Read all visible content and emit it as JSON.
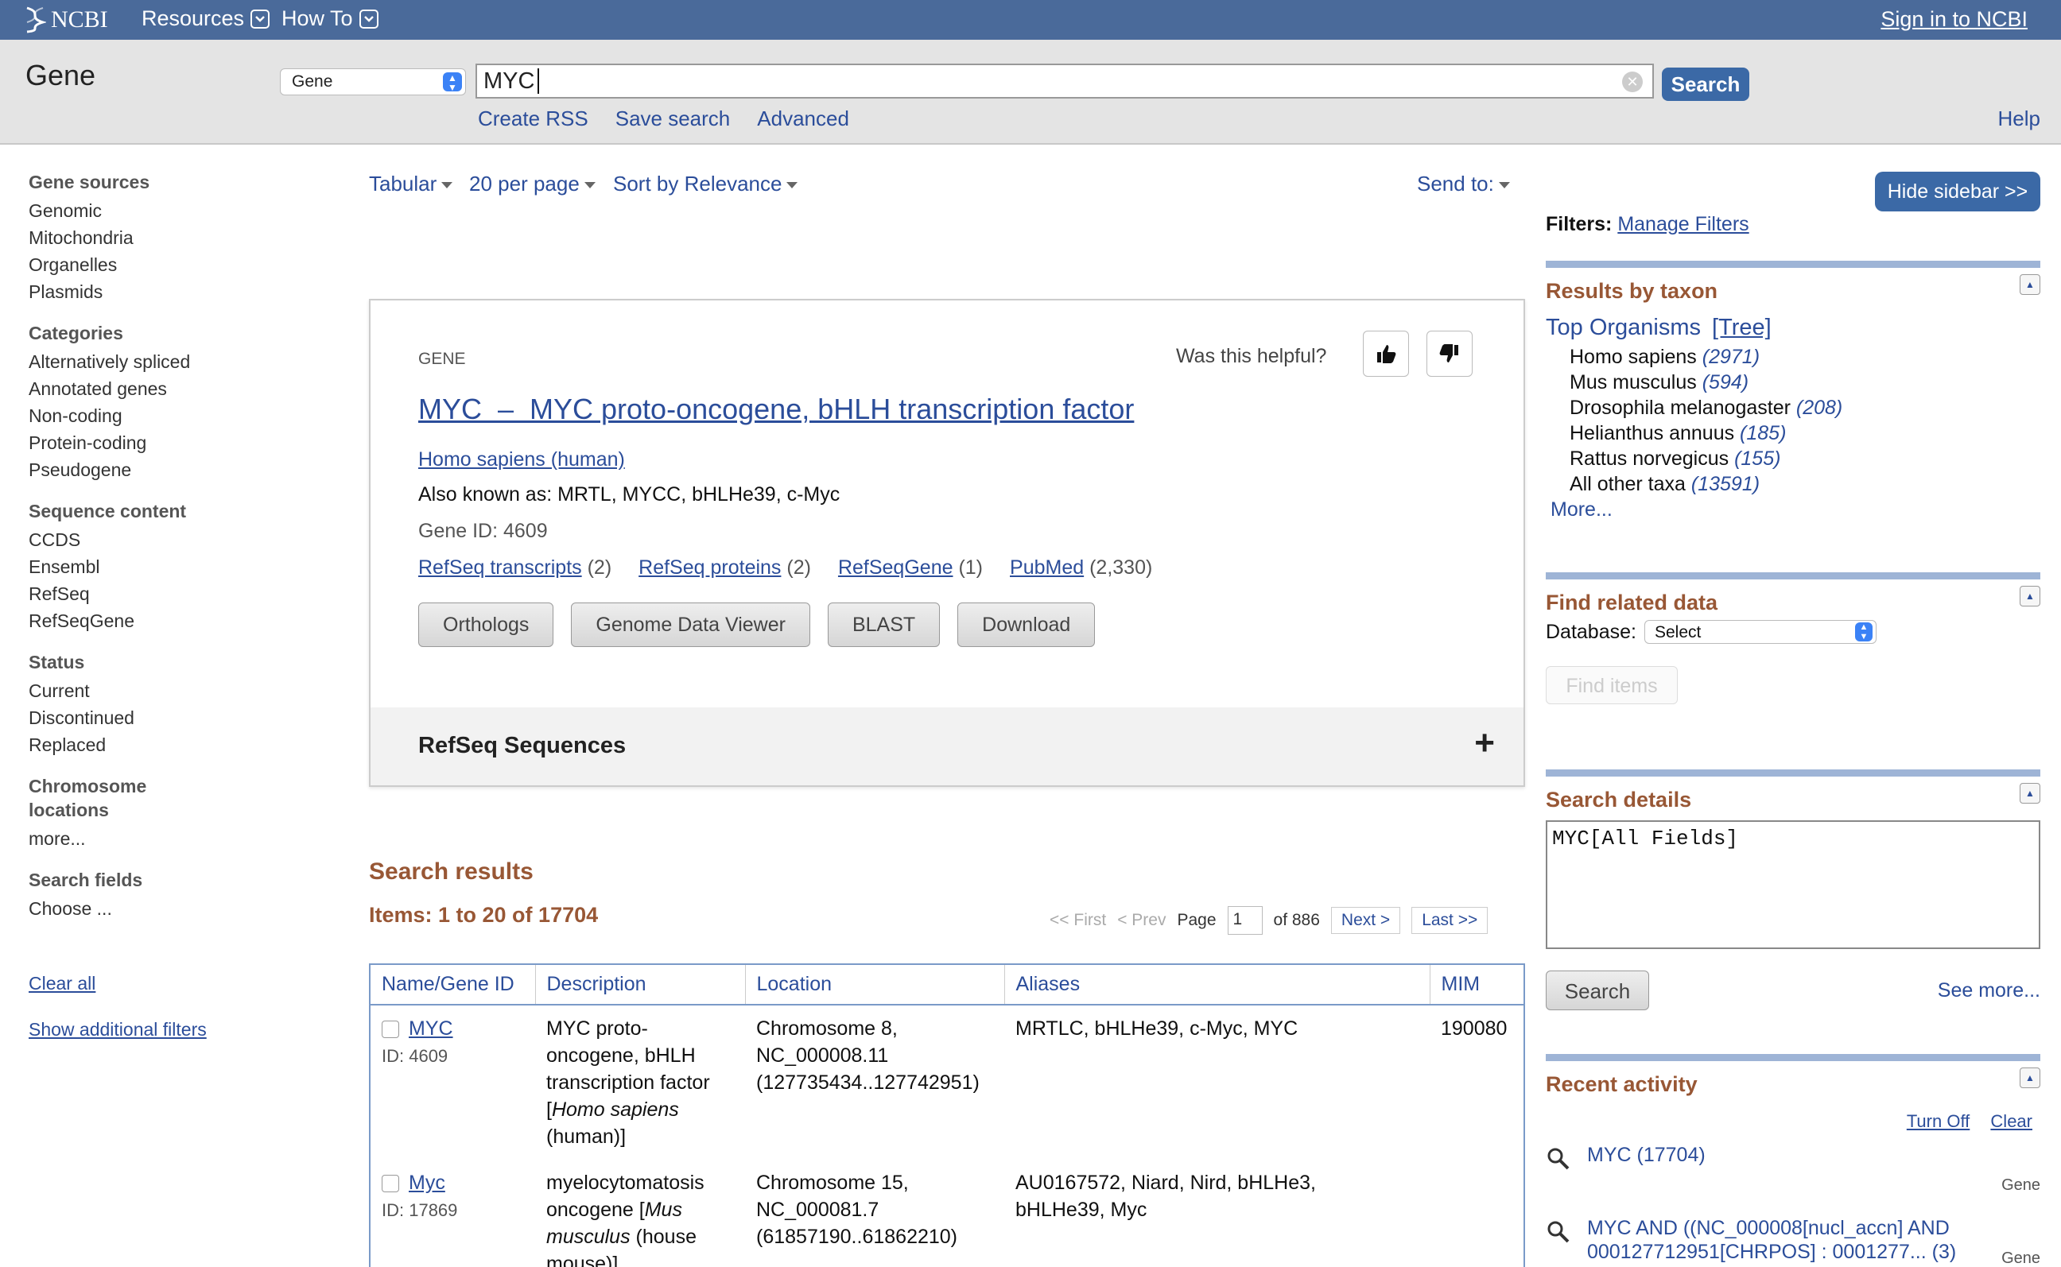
{
  "topnav": {
    "logo": "NCBI",
    "resources": "Resources",
    "howto": "How To",
    "signin": "Sign in to NCBI"
  },
  "searchbar": {
    "db_title": "Gene",
    "db_select": "Gene",
    "query": "MYC",
    "search_button": "Search",
    "create_rss": "Create RSS",
    "save_search": "Save search",
    "advanced": "Advanced",
    "help": "Help"
  },
  "facets": {
    "gene_sources": {
      "head": "Gene sources",
      "items": [
        "Genomic",
        "Mitochondria",
        "Organelles",
        "Plasmids"
      ]
    },
    "categories": {
      "head": "Categories",
      "items": [
        "Alternatively spliced",
        "Annotated genes",
        "Non-coding",
        "Protein-coding",
        "Pseudogene"
      ]
    },
    "sequence_content": {
      "head": "Sequence content",
      "items": [
        "CCDS",
        "Ensembl",
        "RefSeq",
        "RefSeqGene"
      ]
    },
    "status": {
      "head": "Status",
      "items": [
        "Current",
        "Discontinued",
        "Replaced"
      ]
    },
    "chromosome": {
      "head_line1": "Chromosome",
      "head_line2": "locations",
      "more": "more..."
    },
    "search_fields": {
      "head": "Search fields",
      "choose": "Choose ..."
    },
    "clear_all": "Clear all",
    "show_additional": "Show additional filters"
  },
  "display": {
    "format": "Tabular",
    "per_page": "20 per page",
    "sort": "Sort by Relevance",
    "send_to": "Send to:"
  },
  "genecard": {
    "label": "GENE",
    "helpful": "Was this helpful?",
    "title": "MYC  –  MYC proto-oncogene, bHLH transcription factor",
    "organism": "Homo sapiens (human)",
    "aka": "Also known as: MRTL, MYCC, bHLHe39, c-Myc",
    "gene_id": "Gene ID: 4609",
    "links": [
      {
        "label": "RefSeq transcripts",
        "count": "(2)"
      },
      {
        "label": "RefSeq proteins",
        "count": "(2)"
      },
      {
        "label": "RefSeqGene",
        "count": "(1)"
      },
      {
        "label": "PubMed",
        "count": "(2,330)"
      }
    ],
    "buttons": [
      "Orthologs",
      "Genome Data Viewer",
      "BLAST",
      "Download"
    ],
    "refseq_section": "RefSeq Sequences"
  },
  "results": {
    "heading": "Search results",
    "items": "Items: 1 to 20 of 17704",
    "pager": {
      "first": "<< First",
      "prev": "< Prev",
      "page_label": "Page",
      "page": "1",
      "of": "of 886",
      "next": "Next >",
      "last": "Last >>"
    },
    "columns": [
      "Name/Gene ID",
      "Description",
      "Location",
      "Aliases",
      "MIM"
    ],
    "rows": [
      {
        "name": "MYC",
        "id": "ID: 4609",
        "desc_lines": [
          "MYC proto-",
          "oncogene, bHLH",
          "transcription factor"
        ],
        "desc_species": "Homo sapiens",
        "desc_tail": "(human)]",
        "location": [
          "Chromosome 8,",
          "NC_000008.11",
          "(127735434..127742951)"
        ],
        "aliases": "MRTLC, bHLHe39, c-Myc, MYC",
        "mim": "190080"
      },
      {
        "name": "Myc",
        "id": "ID: 17869",
        "desc_lines": [
          "myelocytomatosis"
        ],
        "desc_prefix": "oncogene [",
        "desc_species": "Mus",
        "desc_species2": "musculus",
        "desc_tail": "(house",
        "desc_tail2": "mouse)]",
        "location": [
          "Chromosome 15,",
          "NC_000081.7",
          "(61857190..61862210)"
        ],
        "aliases_line1": "AU0167572, Niard, Nird, bHLHe3,",
        "aliases_line2": "bHLHe39, Myc",
        "mim": ""
      }
    ]
  },
  "sidebar": {
    "hide": "Hide sidebar >>",
    "filters_label": "Filters:",
    "manage_filters": "Manage Filters",
    "taxon": {
      "heading": "Results by taxon",
      "top": "Top Organisms",
      "tree": "[Tree]",
      "orgs": [
        {
          "name": "Homo sapiens",
          "count": "(2971)"
        },
        {
          "name": "Mus musculus",
          "count": "(594)"
        },
        {
          "name": "Drosophila melanogaster",
          "count": "(208)"
        },
        {
          "name": "Helianthus annuus",
          "count": "(185)"
        },
        {
          "name": "Rattus norvegicus",
          "count": "(155)"
        },
        {
          "name": "All other taxa",
          "count": "(13591)"
        }
      ],
      "more": "More..."
    },
    "related": {
      "heading": "Find related data",
      "db_label": "Database:",
      "db_select": "Select",
      "find_items": "Find items"
    },
    "details": {
      "heading": "Search details",
      "query": "MYC[All Fields]",
      "search": "Search",
      "see_more": "See more..."
    },
    "recent": {
      "heading": "Recent activity",
      "turn_off": "Turn Off",
      "clear": "Clear",
      "entries": [
        {
          "text": "MYC (17704)",
          "db": "Gene"
        },
        {
          "text": "MYC AND ((NC_000008[nucl_accn] AND 000127712951[CHRPOS] : 0001277... (3)",
          "db": "Gene"
        }
      ]
    }
  }
}
